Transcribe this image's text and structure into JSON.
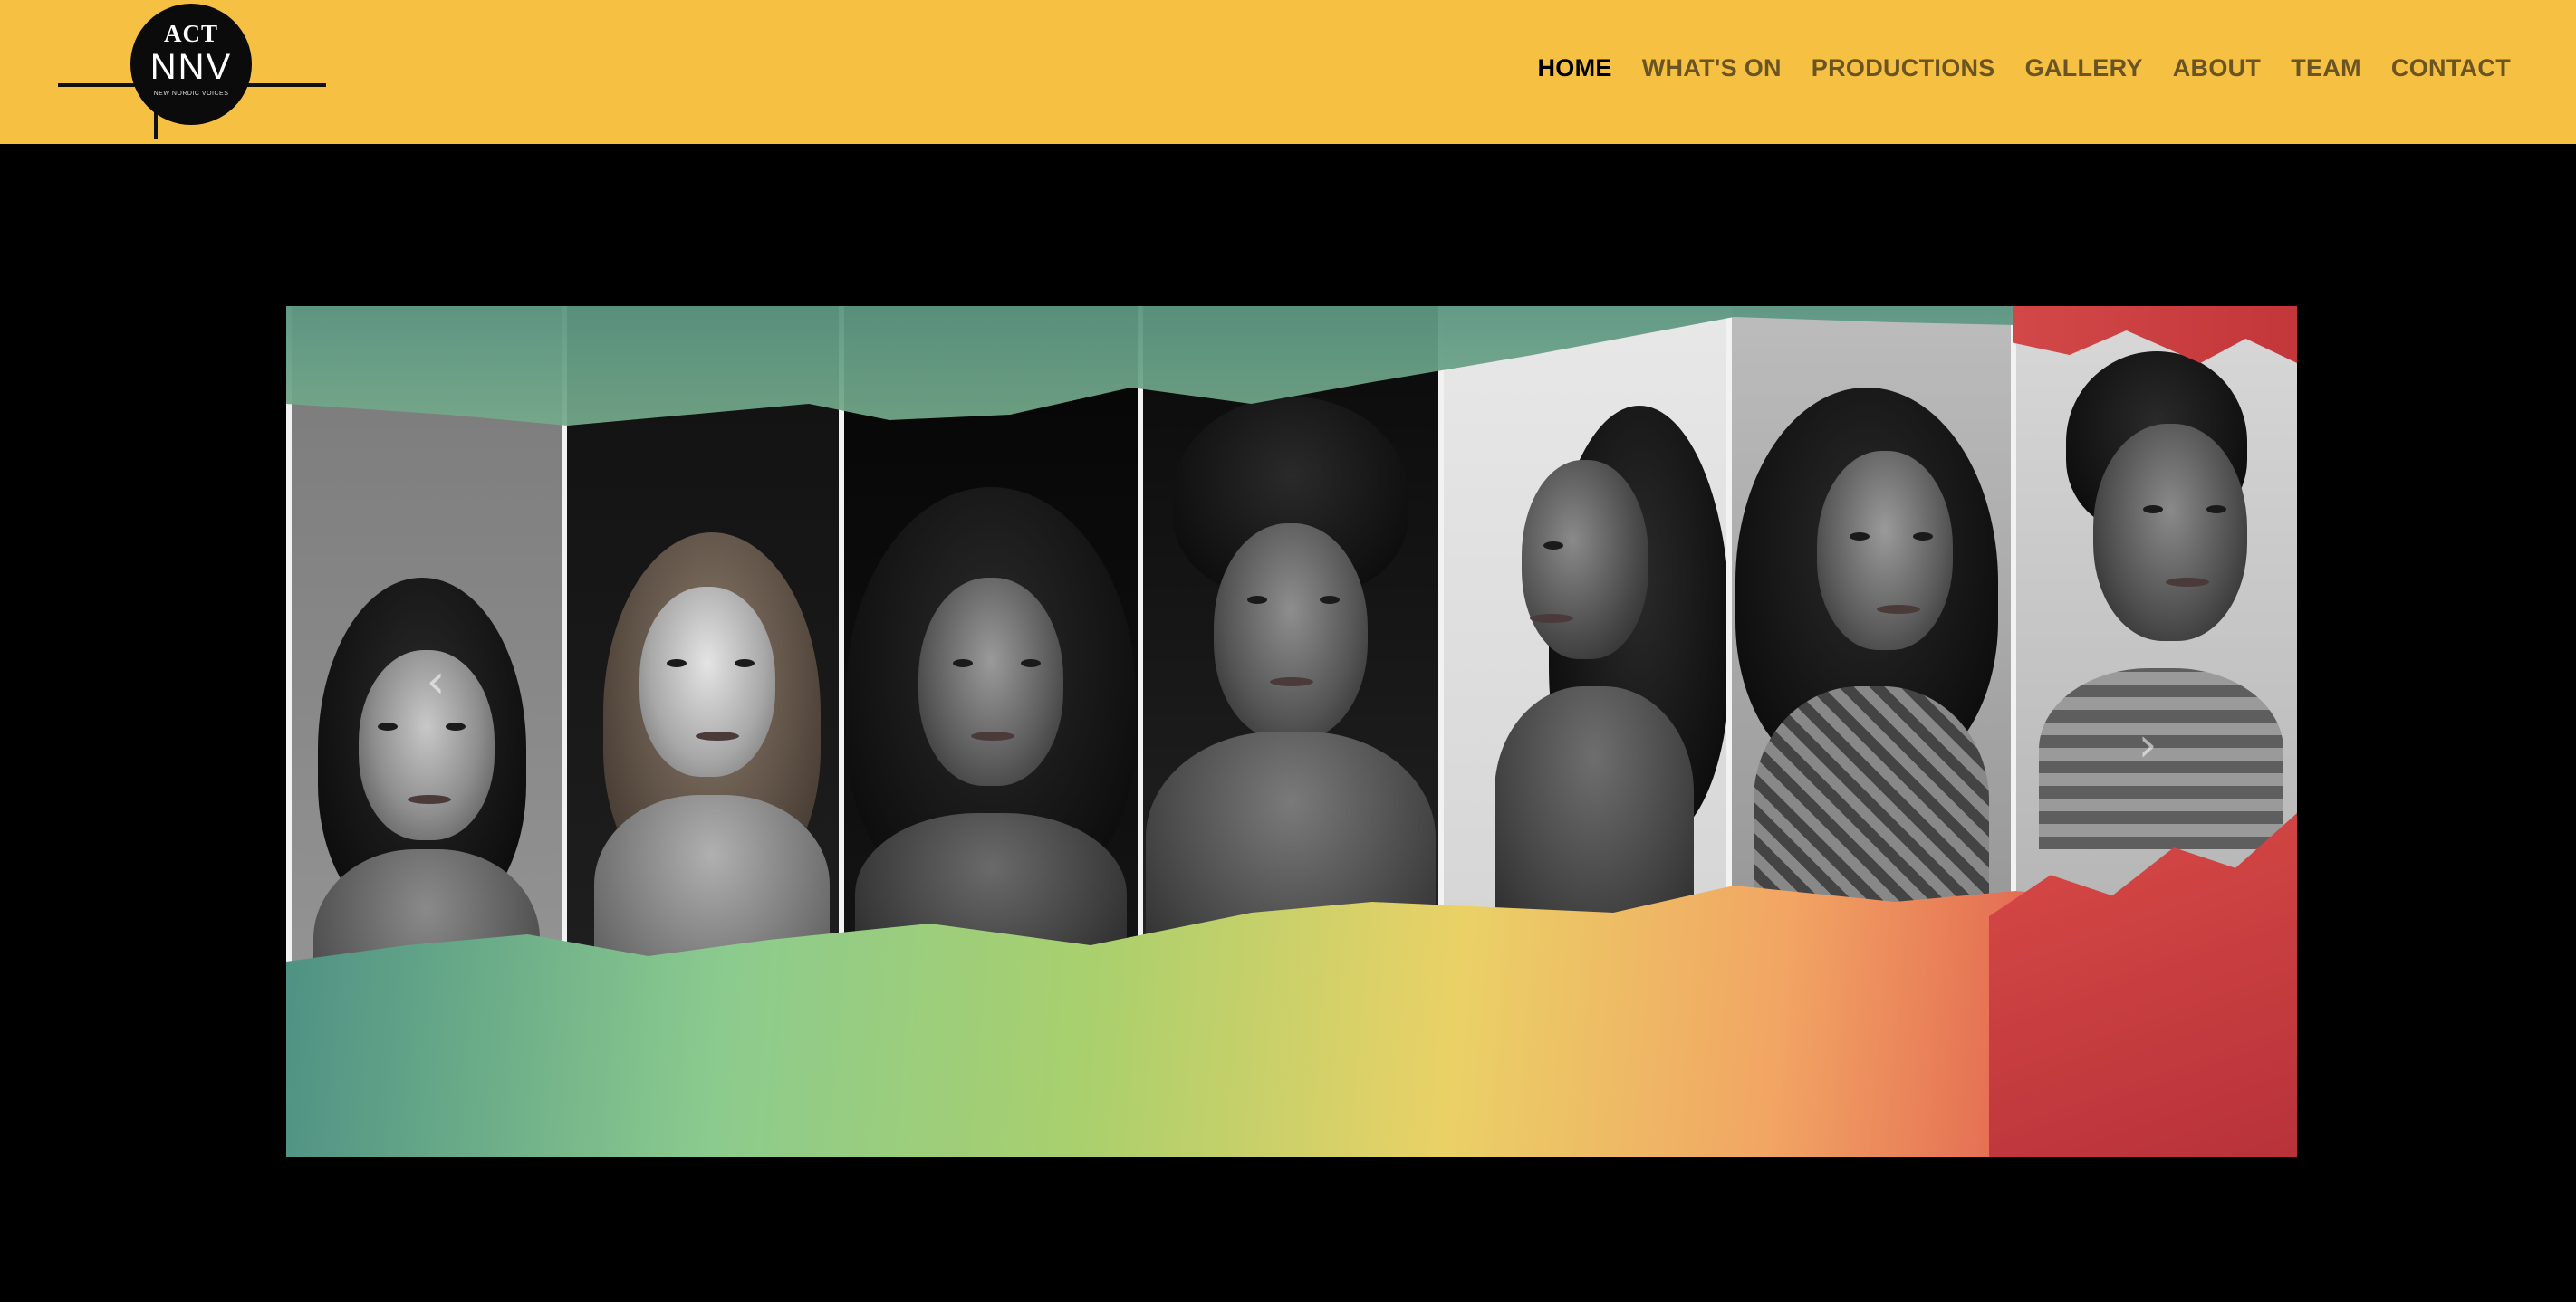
{
  "logo": {
    "top_text": "ACT",
    "main_text": "NNV",
    "sub_text": "NEW NORDIC VOICES",
    "alt": "ACT New Nordic Voices logo"
  },
  "nav": {
    "items": [
      {
        "label": "HOME",
        "active": true
      },
      {
        "label": "WHAT'S ON",
        "active": false
      },
      {
        "label": "PRODUCTIONS",
        "active": false
      },
      {
        "label": "GALLERY",
        "active": false
      },
      {
        "label": "ABOUT",
        "active": false
      },
      {
        "label": "TEAM",
        "active": false
      },
      {
        "label": "CONTACT",
        "active": false
      }
    ]
  },
  "slider": {
    "prev_icon": "chevron-left-icon",
    "next_icon": "chevron-right-icon",
    "prev_glyph": "‹",
    "next_glyph": "›",
    "image_description_hint": "seven black-and-white portraits of women over a colourful painted backdrop"
  },
  "colors": {
    "header_bg": "#f6c143",
    "nav_text": "#6a5424",
    "nav_active": "#000000",
    "page_bg": "#000000"
  }
}
